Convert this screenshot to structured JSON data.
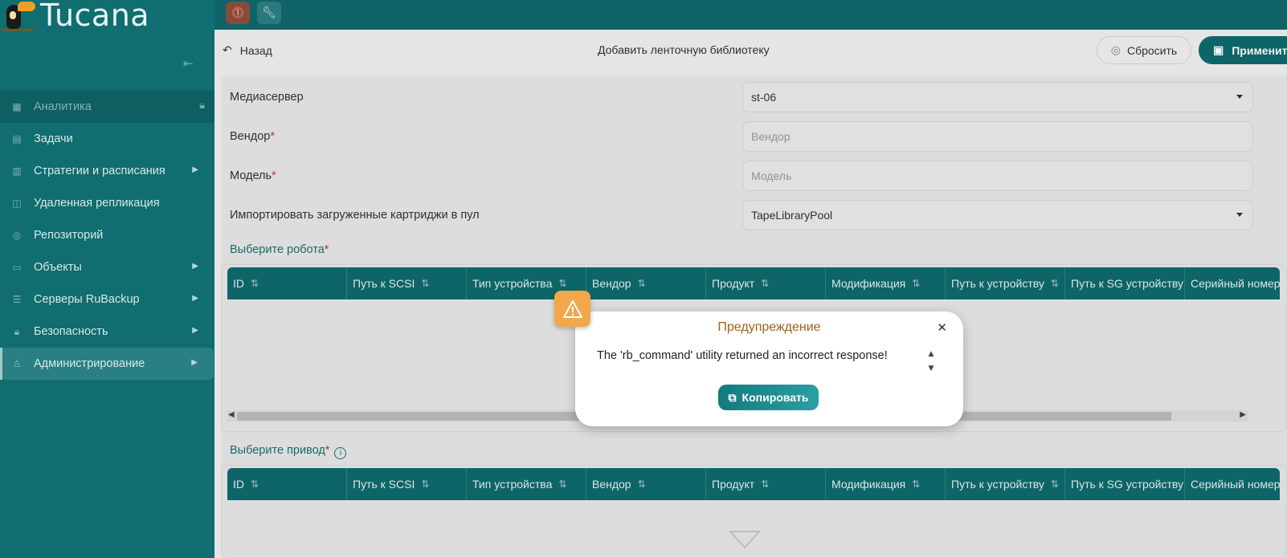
{
  "app": {
    "name": "Tucana"
  },
  "sidebar": {
    "items": [
      {
        "label": "Аналитика"
      },
      {
        "label": "Задачи"
      },
      {
        "label": "Стратегии и расписания"
      },
      {
        "label": "Удаленная репликация"
      },
      {
        "label": "Репозиторий"
      },
      {
        "label": "Объекты"
      },
      {
        "label": "Серверы RuBackup"
      },
      {
        "label": "Безопасность"
      },
      {
        "label": "Администрирование"
      }
    ]
  },
  "toolbar": {
    "back_label": "Назад",
    "title": "Добавить ленточную библиотеку",
    "reset_label": "Сбросить",
    "apply_label": "Применить"
  },
  "form": {
    "mediaserver": {
      "label": "Медиасервер",
      "value": "st-06"
    },
    "vendor": {
      "label": "Вендор",
      "placeholder": "Вендор"
    },
    "model": {
      "label": "Модель",
      "placeholder": "Модель"
    },
    "pool": {
      "label": "Импортировать загруженные картриджи в пул",
      "value": "TapeLibraryPool"
    }
  },
  "robot_section": {
    "label": "Выберите робота"
  },
  "drive_section": {
    "label": "Выберите привод"
  },
  "table_columns": [
    "ID",
    "Путь к SCSI",
    "Тип устройства",
    "Вендор",
    "Продукт",
    "Модификация",
    "Путь к устройству",
    "Путь к SG устройству",
    "Серийный номер"
  ],
  "dialog": {
    "title": "Предупреждение",
    "message": "The 'rb_command' utility returned an incorrect response!",
    "copy_label": "Копировать"
  },
  "colors": {
    "sidebar_bg": "#106d70",
    "accent": "#0f6b6e",
    "warning_badge": "#f2a74a",
    "required": "#c0392b"
  }
}
